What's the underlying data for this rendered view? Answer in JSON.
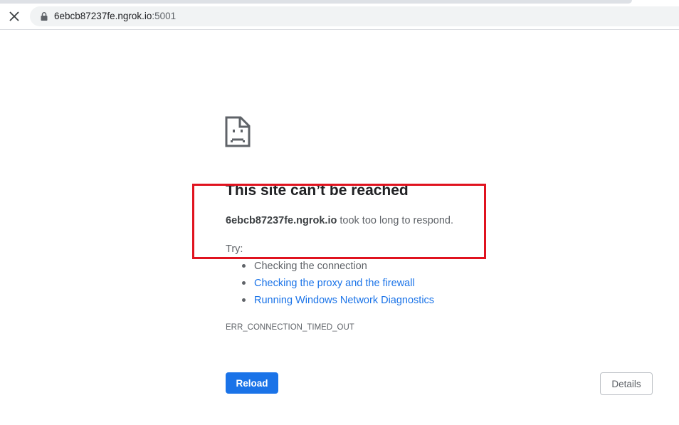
{
  "toolbar": {
    "url_host": "6ebcb87237fe.ngrok.io",
    "url_port": ":5001",
    "close_icon": "close-icon",
    "lock_icon": "lock-icon"
  },
  "error": {
    "icon": "sad-document-icon",
    "title": "This site can’t be reached",
    "host": "6ebcb87237fe.ngrok.io",
    "message": " took too long to respond.",
    "try_label": "Try:",
    "suggestions": [
      "Checking the connection",
      "Checking the proxy and the firewall",
      "Running Windows Network Diagnostics"
    ],
    "code": "ERR_CONNECTION_TIMED_OUT"
  },
  "buttons": {
    "reload": "Reload",
    "details": "Details"
  },
  "colors": {
    "accent": "#1a73e8",
    "highlight": "#e0131f",
    "text": "#202124",
    "muted": "#5f6368"
  }
}
